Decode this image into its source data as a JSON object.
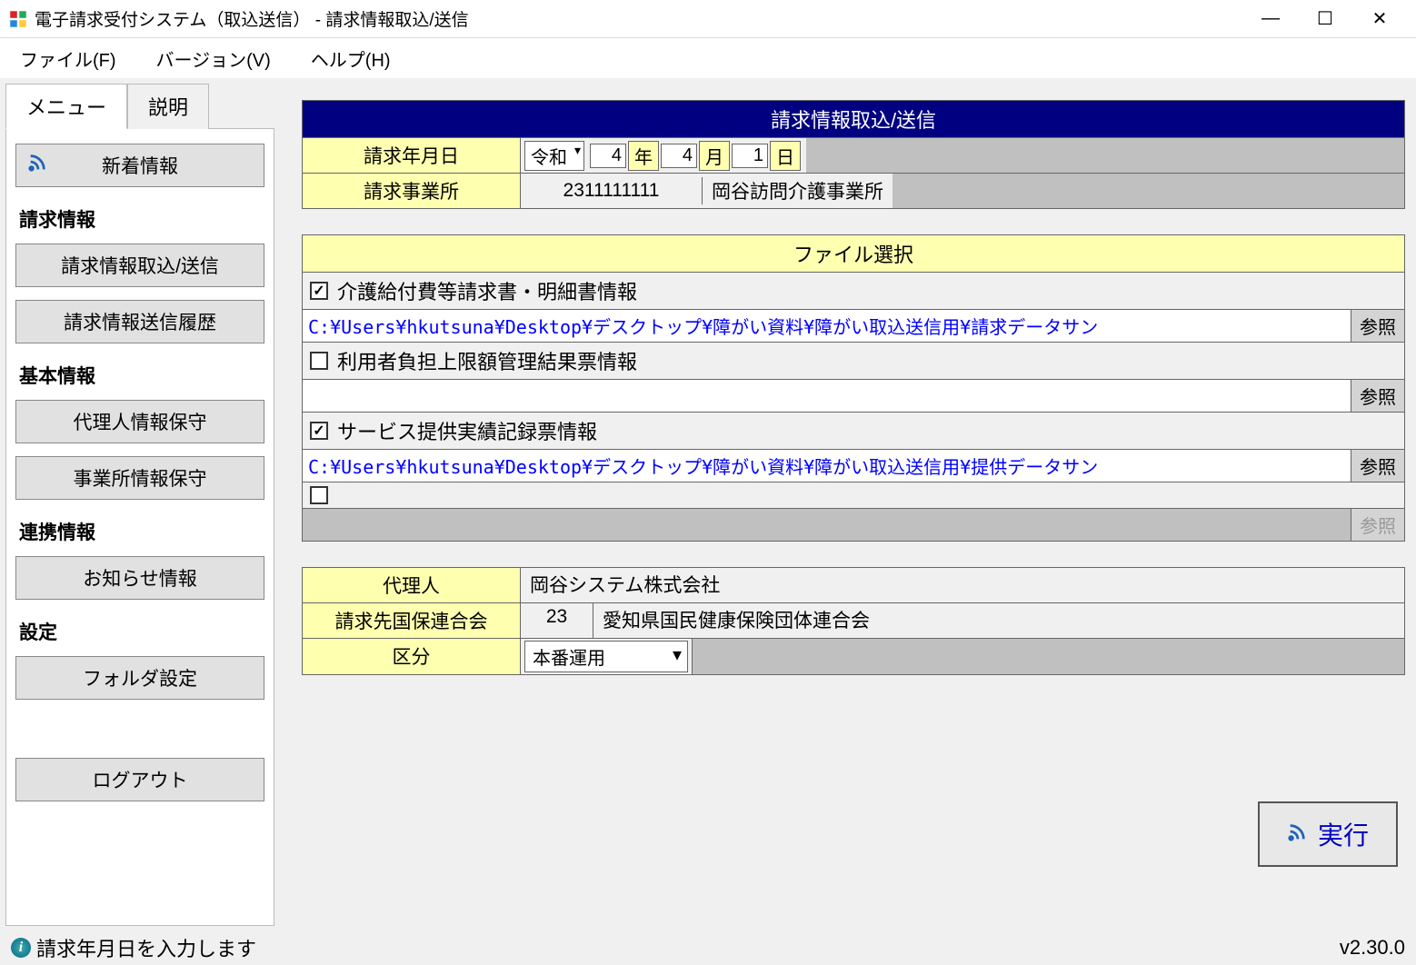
{
  "window": {
    "title": "電子請求受付システム（取込送信） - 請求情報取込/送信"
  },
  "menubar": {
    "file": "ファイル(F)",
    "version": "バージョン(V)",
    "help": "ヘルプ(H)"
  },
  "tabs": {
    "menu": "メニュー",
    "description": "説明"
  },
  "sidebar": {
    "new_info": "新着情報",
    "sections": {
      "billing": "請求情報",
      "basic": "基本情報",
      "linkage": "連携情報",
      "settings": "設定"
    },
    "buttons": {
      "billing_import_send": "請求情報取込/送信",
      "billing_send_history": "請求情報送信履歴",
      "agent_info_maint": "代理人情報保守",
      "office_info_maint": "事業所情報保守",
      "notice_info": "お知らせ情報",
      "folder_settings": "フォルダ設定",
      "logout": "ログアウト"
    }
  },
  "main": {
    "panel_title": "請求情報取込/送信",
    "labels": {
      "billing_date": "請求年月日",
      "billing_office": "請求事業所",
      "era": "令和",
      "year_val": "4",
      "year_suffix": "年",
      "month_val": "4",
      "month_suffix": "月",
      "day_val": "1",
      "day_suffix": "日",
      "office_code": "2311111111",
      "office_name": "岡谷訪問介護事業所"
    },
    "file_section": {
      "title": "ファイル選択",
      "browse": "参照",
      "items": [
        {
          "checked": true,
          "label": "介護給付費等請求書・明細書情報",
          "path": "C:¥Users¥hkutsuna¥Desktop¥デスクトップ¥障がい資料¥障がい取込送信用¥請求データサン",
          "browse_enabled": true
        },
        {
          "checked": false,
          "label": "利用者負担上限額管理結果票情報",
          "path": "",
          "browse_enabled": true
        },
        {
          "checked": true,
          "label": "サービス提供実績記録票情報",
          "path": "C:¥Users¥hkutsuna¥Desktop¥デスクトップ¥障がい資料¥障がい取込送信用¥提供データサン",
          "browse_enabled": true
        },
        {
          "checked": false,
          "label": "",
          "path": "",
          "browse_enabled": false
        }
      ]
    },
    "info": {
      "agent_label": "代理人",
      "agent_value": "岡谷システム株式会社",
      "kokuho_label": "請求先国保連合会",
      "kokuho_code": "23",
      "kokuho_name": "愛知県国民健康保険団体連合会",
      "category_label": "区分",
      "category_value": "本番運用"
    },
    "execute": "実行"
  },
  "statusbar": {
    "message": "請求年月日を入力します",
    "version": "v2.30.0"
  }
}
